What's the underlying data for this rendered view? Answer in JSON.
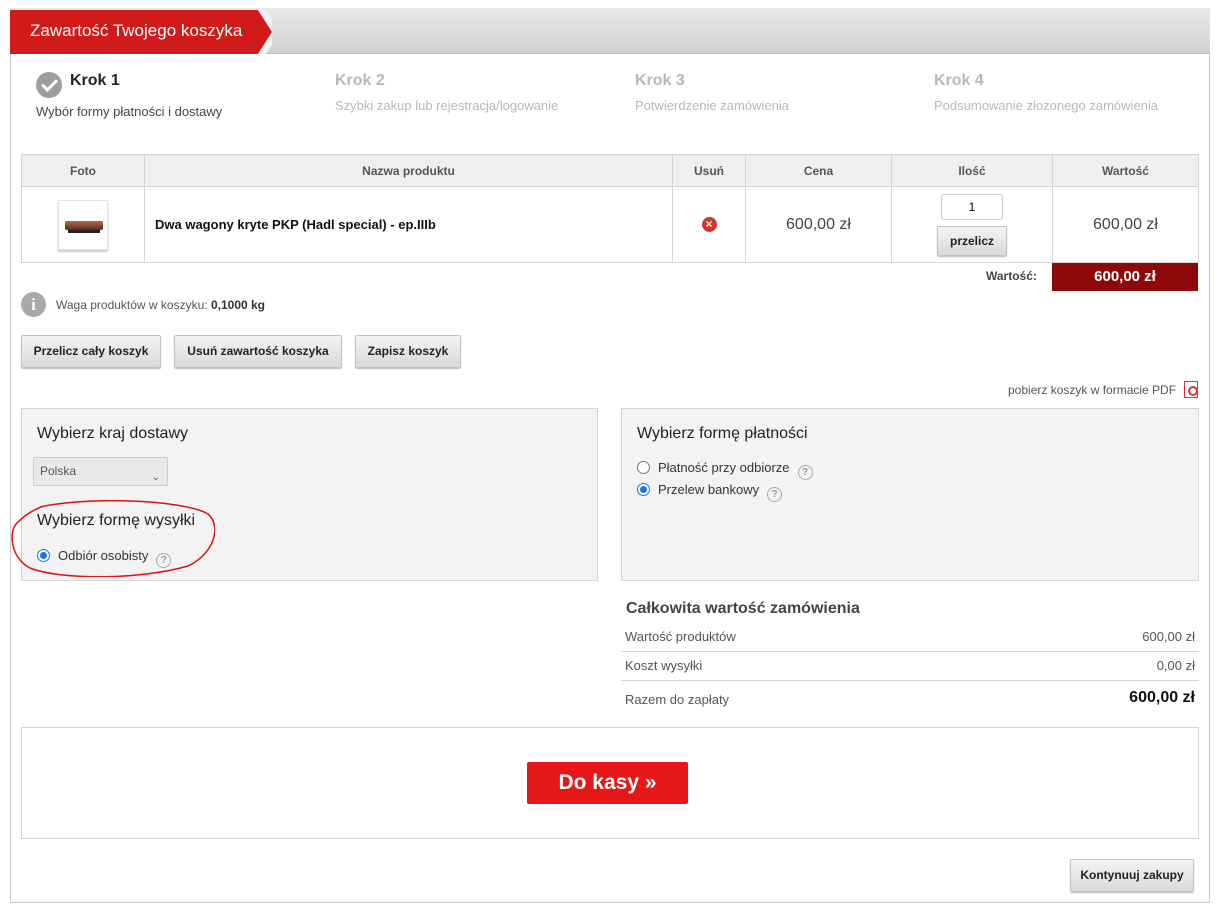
{
  "header": {
    "title": "Zawartość Twojego koszyka",
    "accent": "#d11b1b"
  },
  "steps": [
    {
      "num": "Krok 1",
      "desc": "Wybór formy płatności i dostawy",
      "active": true
    },
    {
      "num": "Krok 2",
      "desc": "Szybki zakup lub rejestracja/logowanie"
    },
    {
      "num": "Krok 3",
      "desc": "Potwierdzenie zamówienia"
    },
    {
      "num": "Krok 4",
      "desc": "Podsumowanie złożonego zamówienia"
    }
  ],
  "table": {
    "headers": [
      "Foto",
      "Nazwa produktu",
      "Usuń",
      "Cena",
      "Ilość",
      "Wartość"
    ],
    "rows": [
      {
        "name": "Dwa wagony kryte PKP (Hadl special) - ep.IIIb",
        "price": "600,00 zł",
        "qty": "1",
        "recalc": "przelicz",
        "value": "600,00 zł"
      }
    ],
    "sum_label": "Wartość:",
    "sum_value": "600,00 zł"
  },
  "weight": {
    "label": "Waga produktów w koszyku:",
    "value": "0,1000 kg"
  },
  "actions": {
    "recalc_all": "Przelicz cały koszyk",
    "clear": "Usuń zawartość koszyka",
    "save": "Zapisz koszyk"
  },
  "pdf_link": "pobierz koszyk w formacie PDF",
  "delivery": {
    "country_title": "Wybierz kraj dostawy",
    "country_selected": "Polska",
    "shipping_title": "Wybierz formę wysyłki",
    "shipping_options": [
      "Odbiór osobisty"
    ]
  },
  "payment": {
    "title": "Wybierz formę płatności",
    "options": [
      "Płatność przy odbiorze",
      "Przelew bankowy"
    ],
    "selected": "Przelew bankowy"
  },
  "totals": {
    "title": "Całkowita wartość zamówienia",
    "products_label": "Wartość produktów",
    "products_value": "600,00 zł",
    "shipping_label": "Koszt wysyłki",
    "shipping_value": "0,00 zł",
    "total_label": "Razem do zapłaty",
    "total_value": "600,00 zł"
  },
  "checkout_label": "Do kasy »",
  "continue_label": "Kontynuuj zakupy"
}
